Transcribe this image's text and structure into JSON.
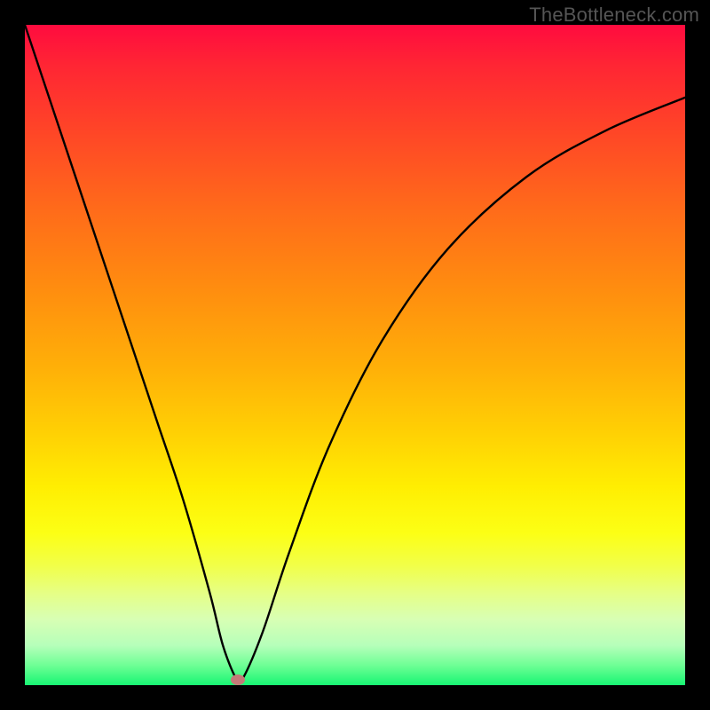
{
  "watermark": "TheBottleneck.com",
  "chart_data": {
    "type": "line",
    "title": "",
    "xlabel": "",
    "ylabel": "",
    "xlim": [
      0,
      100
    ],
    "ylim": [
      0,
      100
    ],
    "grid": false,
    "series": [
      {
        "name": "curve",
        "x": [
          0,
          4,
          8,
          12,
          16,
          20,
          24,
          28,
          30,
          32,
          33,
          36,
          40,
          46,
          54,
          64,
          76,
          88,
          100
        ],
        "values": [
          100,
          88,
          76,
          64,
          52,
          40,
          28,
          14,
          6,
          1,
          1,
          8,
          20,
          36,
          52,
          66,
          77,
          84,
          89
        ]
      }
    ],
    "marker": {
      "x": 32.2,
      "y": 0.8,
      "color": "#c47a78"
    },
    "background_gradient": {
      "stops": [
        {
          "pos": 0.0,
          "color": "#ff0b3f"
        },
        {
          "pos": 0.4,
          "color": "#ff8d0f"
        },
        {
          "pos": 0.7,
          "color": "#ffee02"
        },
        {
          "pos": 0.9,
          "color": "#d8ffb4"
        },
        {
          "pos": 1.0,
          "color": "#18f573"
        }
      ]
    }
  }
}
